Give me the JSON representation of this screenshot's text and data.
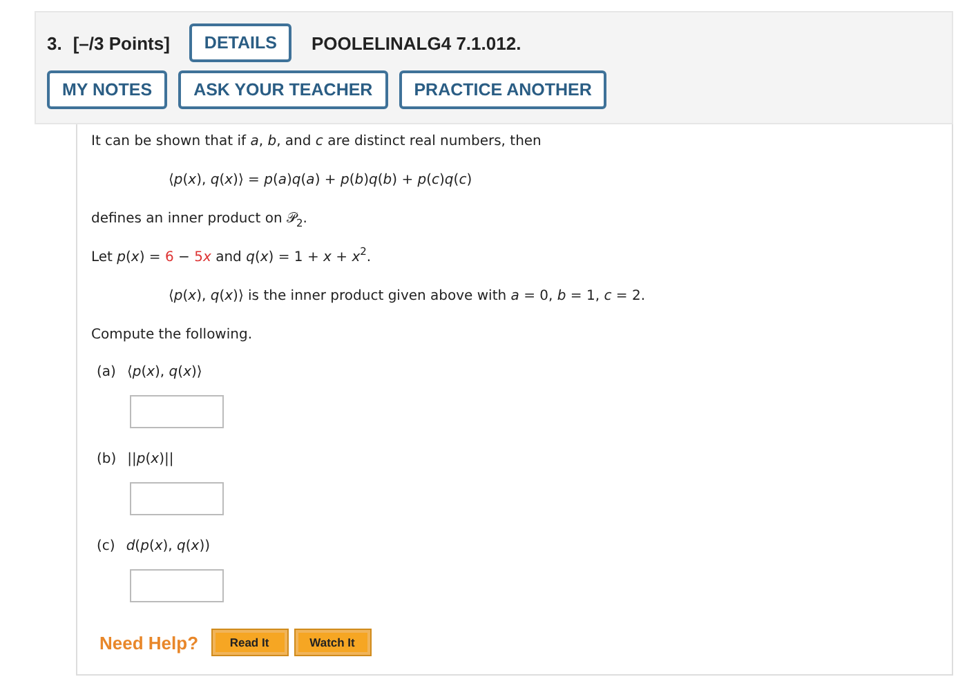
{
  "question": {
    "number": "3.",
    "points": "[–/3 Points]",
    "details_button": "DETAILS",
    "code": "POOLELINALG4 7.1.012.",
    "actions": [
      "MY NOTES",
      "ASK YOUR TEACHER",
      "PRACTICE ANOTHER"
    ]
  },
  "body": [
    {
      "kind": "text",
      "text": "It can be shown that if *a*, *b*, and *c* are distinct real numbers, then"
    },
    {
      "kind": "math",
      "text": "⟨*p*(*x*), *q*(*x*)⟩ = *p*(*a*)*q*(*a*) + *p*(*b*)*q*(*b*) + *p*(*c*)*q*(*c*)"
    },
    {
      "kind": "text",
      "text": "defines an inner product on 𝒫$_{2}$."
    },
    {
      "kind": "segments",
      "segments": [
        {
          "text": "Let *p*(*x*) = ",
          "given": false
        },
        {
          "text": "6",
          "given": true
        },
        {
          "text": " − ",
          "given": false
        },
        {
          "text": "5",
          "given": true
        },
        {
          "text": "*x*",
          "given": true
        },
        {
          "text": " and *q*(*x*) = 1 + *x* + *x*$^{2}$.",
          "given": false
        }
      ]
    },
    {
      "kind": "math",
      "text": "⟨*p*(*x*), *q*(*x*)⟩ is the inner product given above with *a* = 0, *b* = 1, *c* = 2."
    },
    {
      "kind": "text",
      "text": "Compute the following."
    }
  ],
  "parts": [
    {
      "label": "(a)",
      "expression": "⟨*p*(*x*), *q*(*x*)⟩"
    },
    {
      "label": "(b)",
      "expression": "||*p*(*x*)||"
    },
    {
      "label": "(c)",
      "expression": "*d*(*p*(*x*), *q*(*x*))"
    }
  ],
  "help": {
    "label": "Need Help?",
    "buttons": [
      "Read It",
      "Watch It"
    ]
  }
}
